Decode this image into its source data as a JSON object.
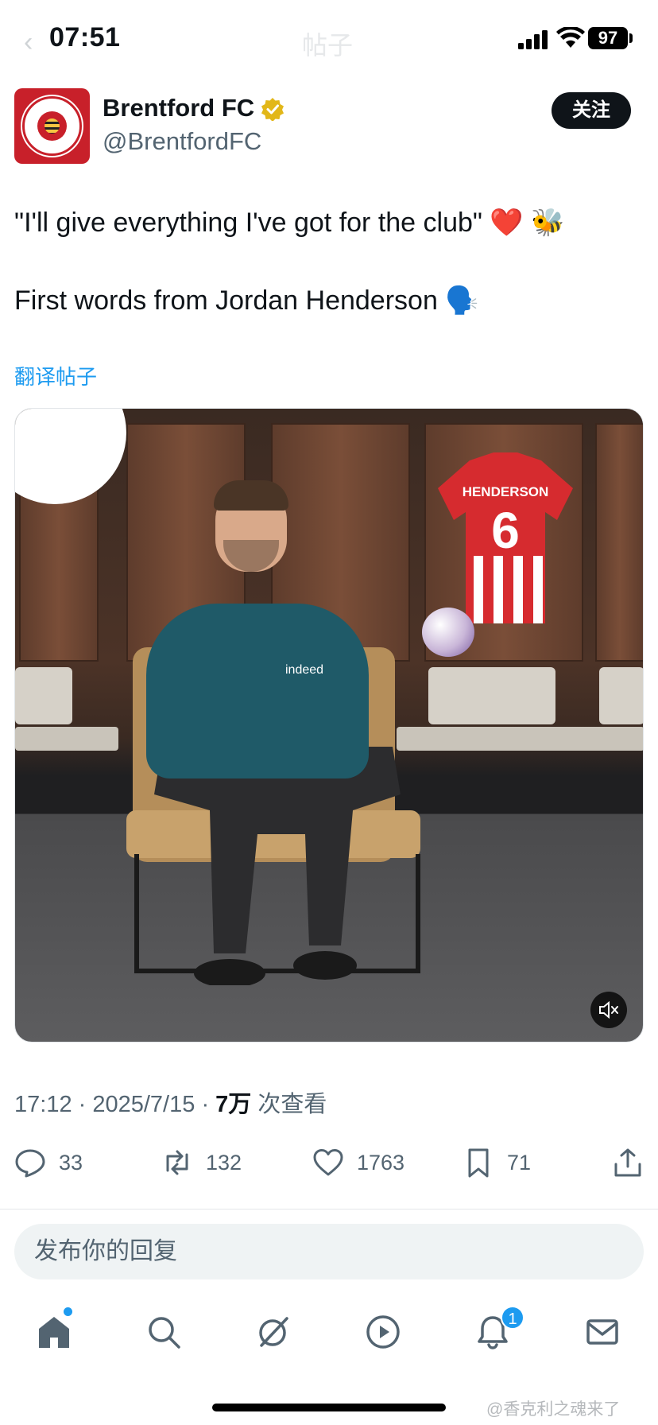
{
  "status_bar": {
    "time": "07:51",
    "battery": "97",
    "ghost_title": "帖子"
  },
  "author": {
    "name": "Brentford FC",
    "handle": "@BrentfordFC",
    "verified": true,
    "follow_label": "关注"
  },
  "tweet": {
    "line1": "\"I'll give everything I've got for the club\" ❤️ 🐝",
    "line2": "First words from Jordan Henderson 🗣️",
    "translate_label": "翻译帖子"
  },
  "media": {
    "jersey_name": "HENDERSON",
    "jersey_number": "6",
    "shirt_sponsor": "indeed",
    "mute_icon": "volume-muted-icon"
  },
  "meta": {
    "time": "17:12",
    "date": "2025/7/15",
    "views": "7万",
    "views_label": "次查看"
  },
  "actions": {
    "replies": "33",
    "reposts": "132",
    "likes": "1763",
    "bookmarks": "71"
  },
  "reply_box": {
    "placeholder": "发布你的回复"
  },
  "nav": {
    "notifications_badge": "1"
  },
  "watermark": "@香克利之魂来了",
  "colors": {
    "accent": "#1d9bf0",
    "text_primary": "#0f1419",
    "text_secondary": "#536471",
    "brand_red": "#c8202a"
  }
}
